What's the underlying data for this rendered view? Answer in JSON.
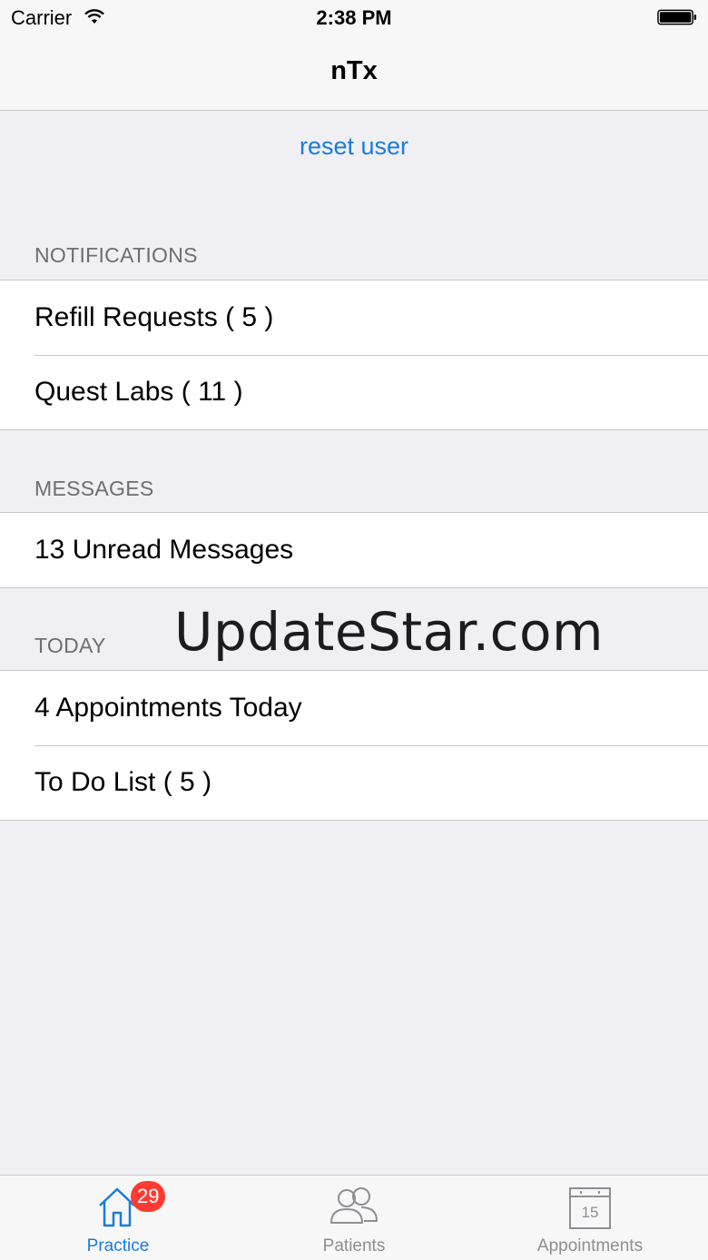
{
  "status_bar": {
    "carrier": "Carrier",
    "time": "2:38 PM"
  },
  "nav": {
    "title": "nTx"
  },
  "reset_link": "reset user",
  "sections": {
    "notifications": {
      "header": "NOTIFICATIONS",
      "items": [
        "Refill Requests ( 5 )",
        "Quest Labs ( 11 )"
      ]
    },
    "messages": {
      "header": "MESSAGES",
      "items": [
        "13 Unread Messages"
      ]
    },
    "today": {
      "header": "TODAY",
      "items": [
        "4 Appointments Today",
        "To Do List ( 5 )"
      ]
    }
  },
  "watermark": "UpdateStar.com",
  "tabbar": {
    "tabs": [
      {
        "label": "Practice",
        "icon": "house-icon",
        "badge": "29",
        "active": true
      },
      {
        "label": "Patients",
        "icon": "people-icon",
        "active": false
      },
      {
        "label": "Appointments",
        "icon": "calendar-icon",
        "calendar_day": "15",
        "active": false
      }
    ]
  },
  "colors": {
    "accent": "#1a7cd9",
    "badge": "#ff3b30",
    "inactive": "#8e8e93",
    "background": "#efeff4"
  }
}
